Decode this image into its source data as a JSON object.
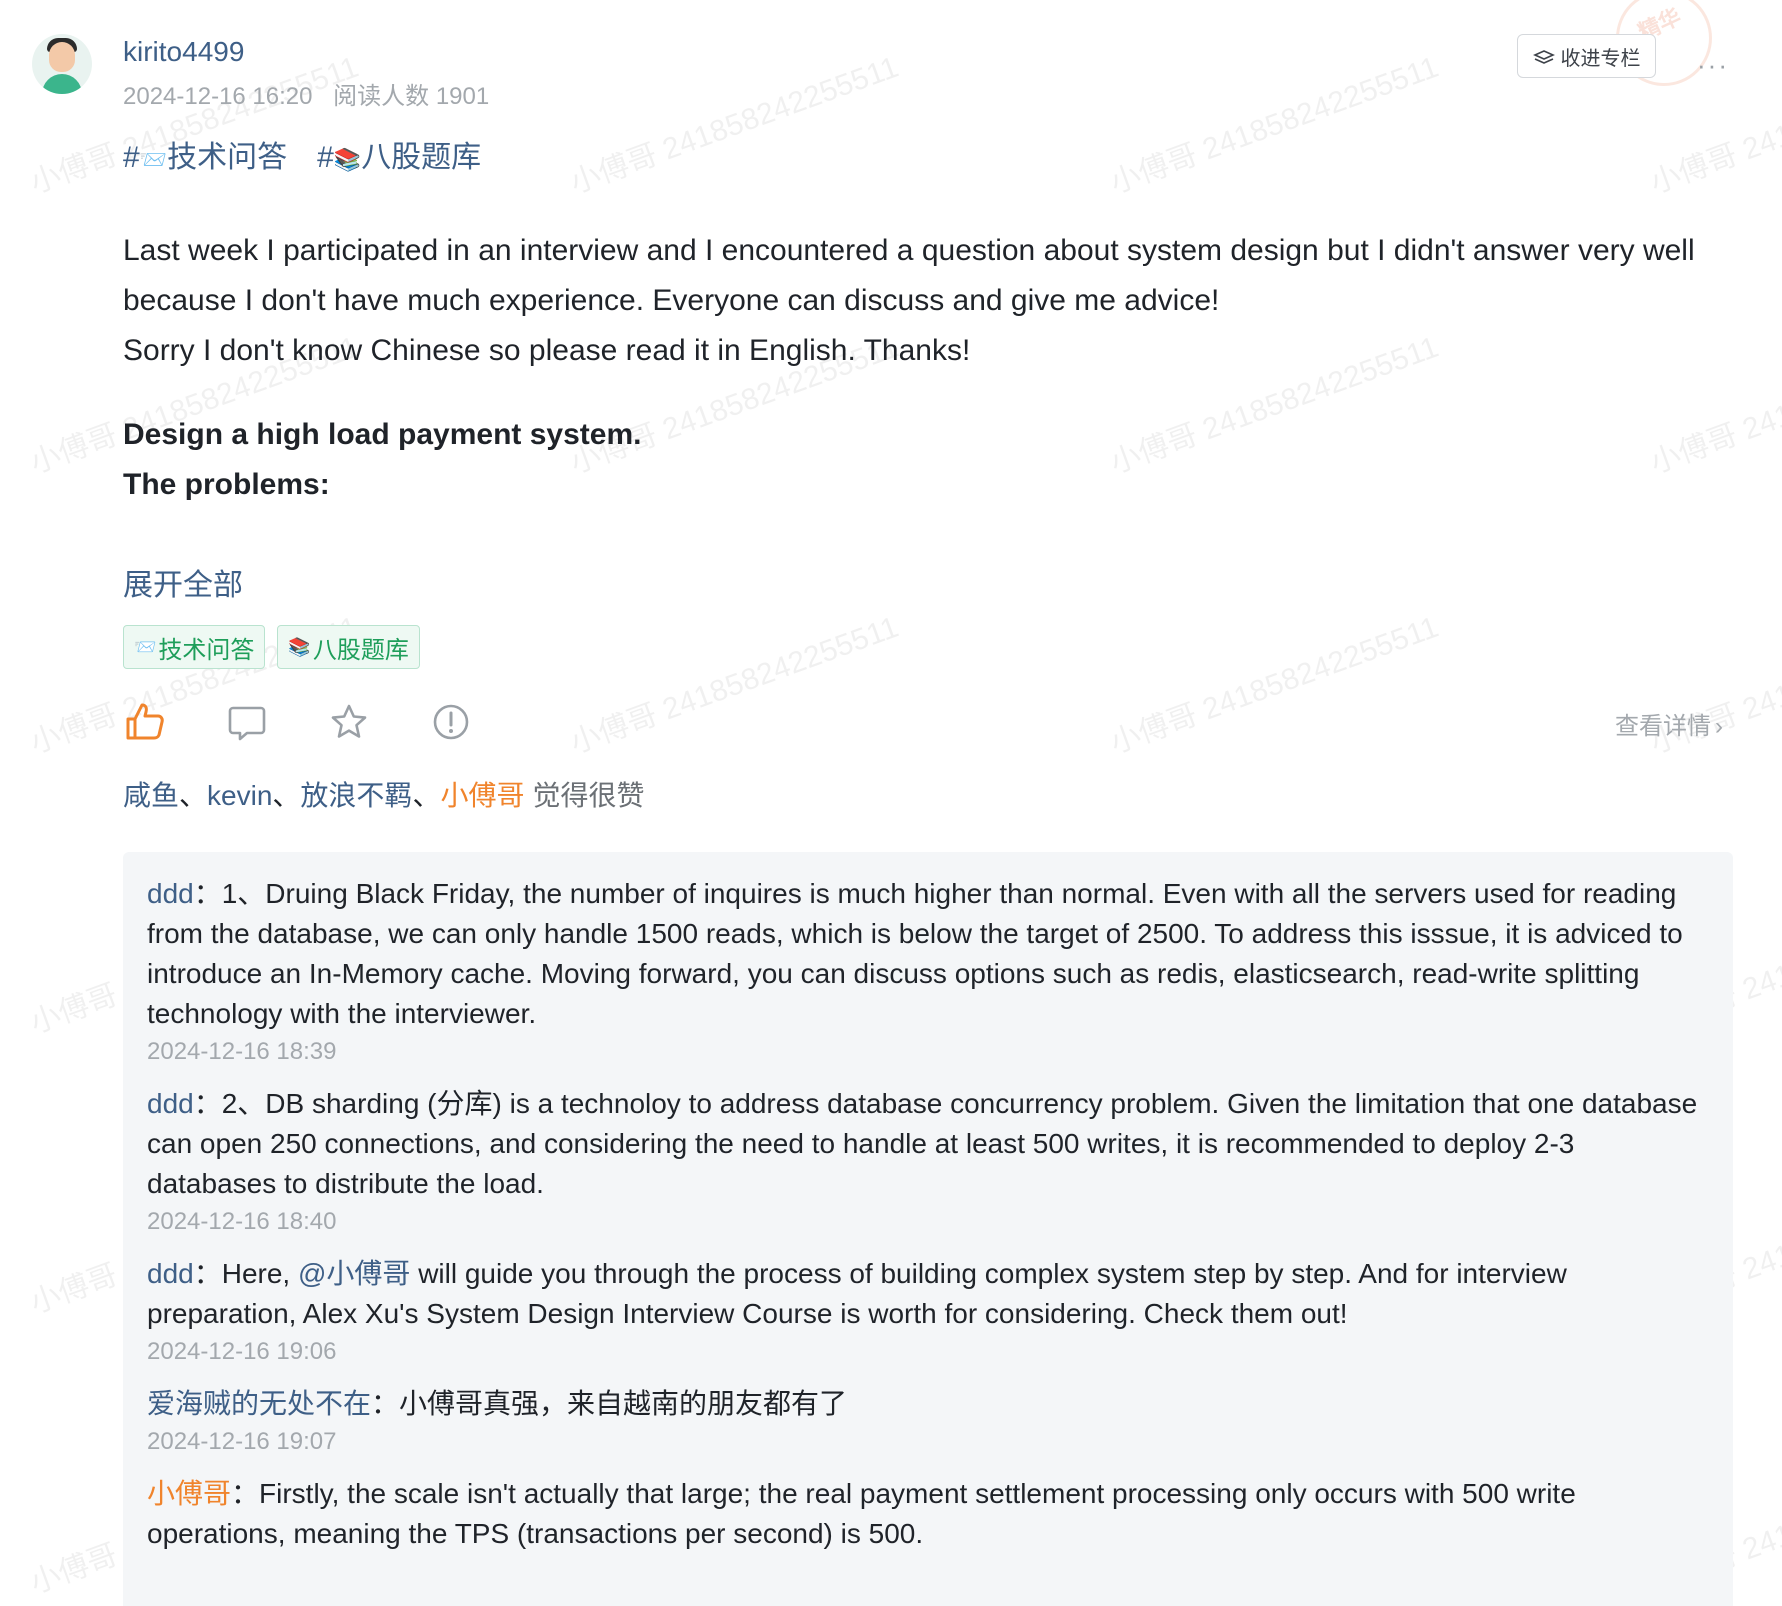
{
  "watermark_text": "小傅哥 241858242255511",
  "stamp_text": "精华",
  "author": {
    "username": "kirito4499",
    "date": "2024-12-16 16:20",
    "reads": "阅读人数 1901"
  },
  "header": {
    "collect_label": "收进专栏",
    "more_label": "···"
  },
  "topics": [
    {
      "prefix": "#",
      "emoji": "📨",
      "label": "技术问答"
    },
    {
      "prefix": "#",
      "emoji": "📚",
      "label": "八股题库"
    }
  ],
  "post": {
    "para1": "Last week I participated in an interview and I encountered a question about system design but I didn't answer very well because I don't have much experience. Everyone can discuss and give me advice!",
    "para2": "Sorry I don't know Chinese so please read it in English. Thanks!",
    "heading": "Design a high load payment system.",
    "subheading": "The problems:",
    "expand_label": "展开全部"
  },
  "tags": [
    {
      "emoji": "📨",
      "label": "技术问答"
    },
    {
      "emoji": "📚",
      "label": "八股题库"
    }
  ],
  "actions": {
    "detail_label": "查看详情"
  },
  "likers": {
    "names": [
      "咸鱼",
      "kevin",
      "放浪不羁"
    ],
    "highlight_name": "小傅哥",
    "separator": "、",
    "suffix": "觉得很赞"
  },
  "comments": [
    {
      "author": "ddd",
      "text": "1、Druing Black Friday, the number of inquires is much higher than normal. Even with all the servers used for reading from the database, we can only handle 1500 reads, which is below the target of 2500. To address this isssue, it is adviced to introduce an In-Memory cache. Moving forward, you can discuss options such as redis, elasticsearch, read-write splitting technology with the interviewer.",
      "time": "2024-12-16 18:39"
    },
    {
      "author": "ddd",
      "text": "2、DB sharding (分库) is a technoloy to address database concurrency problem.  Given the limitation that one database can open 250 connections, and considering the need to handle at least 500 writes, it is recommended to deploy 2-3 databases to distribute the load.",
      "time": "2024-12-16 18:40"
    },
    {
      "author": "ddd",
      "text_before": "Here, ",
      "mention": "@小傅哥",
      "text_after": " will guide you through the process of building complex system step by step. And for interview preparation,  Alex Xu's System Design Interview Course is worth for considering.  Check them out!",
      "time": "2024-12-16 19:06"
    },
    {
      "author": "爱海贼的无处不在",
      "text": "小傅哥真强，来自越南的朋友都有了",
      "time": "2024-12-16 19:07"
    },
    {
      "author": "小傅哥",
      "text": "Firstly, the scale isn't actually that large; the real payment settlement processing only occurs with 500 write operations, meaning the TPS (transactions per second) is 500."
    }
  ],
  "comment_separator": "：",
  "colors": {
    "link": "#3e5f87",
    "accent": "#f0842c",
    "tag_green": "#1e9e5a",
    "muted": "#a3a8ad"
  }
}
